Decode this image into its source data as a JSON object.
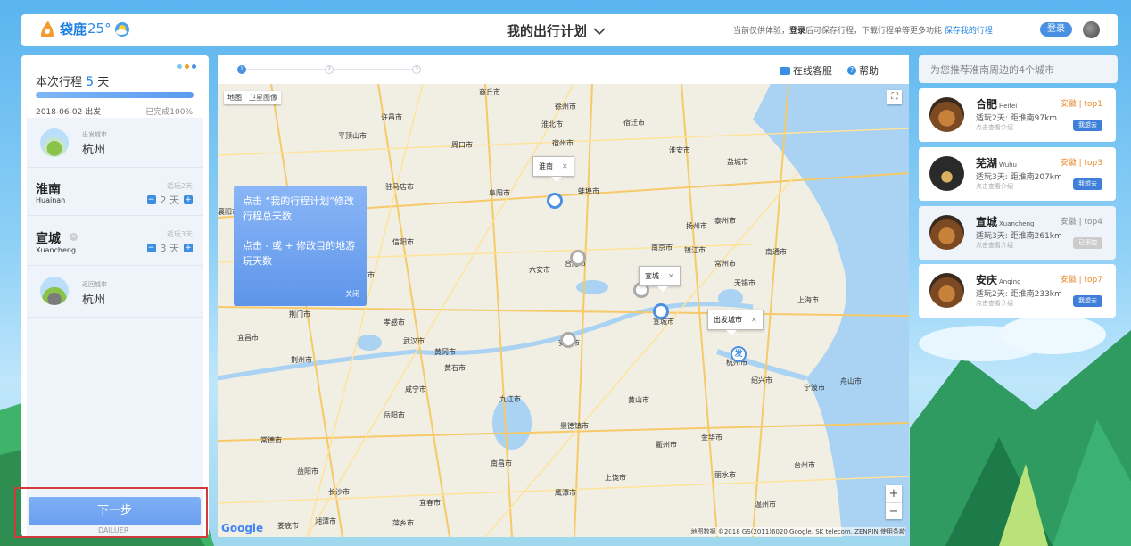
{
  "header": {
    "logo_text": "袋鹿",
    "temperature": "25°",
    "weather_icon": "partly-cloudy-icon",
    "title": "我的出行计划",
    "hint_prefix": "当前仅供体验，",
    "hint_login": "登录",
    "hint_middle": "后可保存行程，下载行程单等更多功能",
    "hint_link": "保存我的行程",
    "login_label": "登录"
  },
  "left": {
    "dot_colors": [
      "#7ec8e3",
      "#f0a020",
      "#4a90e2"
    ],
    "trip_prefix": "本次行程",
    "trip_days": "5",
    "trip_unit": "天",
    "progress_percent": 100,
    "start_date": "2018-06-02 出发",
    "completed": "已完成100%",
    "departure": {
      "label": "出发城市",
      "city": "杭州"
    },
    "stops": [
      {
        "name": "淮南",
        "pinyin": "Huainan",
        "suggest": "适玩2天",
        "days": "2 天"
      },
      {
        "name": "宣城",
        "pinyin": "Xuancheng",
        "suggest": "适玩3天",
        "days": "3 天"
      }
    ],
    "return": {
      "label": "返回城市",
      "city": "杭州"
    },
    "next_label": "下一步",
    "watermark": "DAILUER"
  },
  "map": {
    "steps": [
      "1",
      "2",
      "3"
    ],
    "service_label": "在线客服",
    "help_label": "帮助",
    "type_map": "地图",
    "type_satellite": "卫星图像",
    "tooltip_line1": "点击 “我的行程计划”修改行程总天数",
    "tooltip_line2": "点击 - 或 + 修改目的地游玩天数",
    "tooltip_close": "关闭",
    "popup_huainan": "淮南",
    "popup_xuancheng": "宣城",
    "popup_departure": "出发城市",
    "marker_departure": "发",
    "google": "Google",
    "attribution": "地图数据 ©2018 GS(2011)6020 Google, SK telecom, ZENRIN   使用条款",
    "labels": {
      "l1": "商丘市",
      "l2": "徐州市",
      "l3": "许昌市",
      "l4": "平顶山市",
      "l5": "周口市",
      "l6": "淮北市",
      "l7": "宿迁市",
      "l8": "宿州市",
      "l9": "淮安市",
      "l10": "盐城市",
      "l11": "驻马店市",
      "l12": "阜阳市",
      "l13": "蚌埠市",
      "l14": "扬州市",
      "l15": "泰州市",
      "l16": "信阳市",
      "l17": "南京市",
      "l18": "镇江市",
      "l19": "六安市",
      "l20": "合肥市",
      "l21": "常州市",
      "l22": "南通市",
      "l23": "无锡市",
      "l24": "荆门市",
      "l25": "孝感市",
      "l26": "上海市",
      "l27": "宜昌市",
      "l28": "武汉市",
      "l29": "黄冈市",
      "l30": "安庆市",
      "l31": "黄石市",
      "l32": "杭州市",
      "l33": "咸宁市",
      "l34": "九江市",
      "l35": "黄山市",
      "l36": "绍兴市",
      "l37": "宁波市",
      "l38": "舟山市",
      "l39": "景德镇市",
      "l40": "常德市",
      "l41": "金华市",
      "l42": "衢州市",
      "l43": "南昌市",
      "l44": "益阳市",
      "l45": "上饶市",
      "l46": "台州市",
      "l47": "长沙市",
      "l48": "丽水市",
      "l49": "温州市",
      "l50": "湘潭市",
      "l51": "娄底市",
      "l52": "萍乡市",
      "l53": "宜春市",
      "l54": "鹰潭市",
      "l55": "荆州市",
      "l56": "岳阳市",
      "l57": "随州市",
      "l58": "襄阳市",
      "l59": "宣城市"
    }
  },
  "recommend": {
    "title": "为您推荐淮南周边的4个城市",
    "cards": [
      {
        "name": "合肥",
        "en": "Heifei",
        "info": "适玩2天: 距淮南97km",
        "more": "点击查看介绍",
        "rank": "安徽 | top1",
        "btn": "我想去"
      },
      {
        "name": "芜湖",
        "en": "Wuhu",
        "info": "适玩3天: 距淮南207km",
        "more": "点击查看介绍",
        "rank": "安徽 | top3",
        "btn": "我想去"
      },
      {
        "name": "宣城",
        "en": "Xuancheng",
        "info": "适玩3天: 距淮南261km",
        "more": "点击查看介绍",
        "rank": "安徽 | top4",
        "btn": "已添加"
      },
      {
        "name": "安庆",
        "en": "Anqing",
        "info": "适玩2天: 距淮南233km",
        "more": "点击查看介绍",
        "rank": "安徽 | top7",
        "btn": "我想去"
      }
    ]
  }
}
